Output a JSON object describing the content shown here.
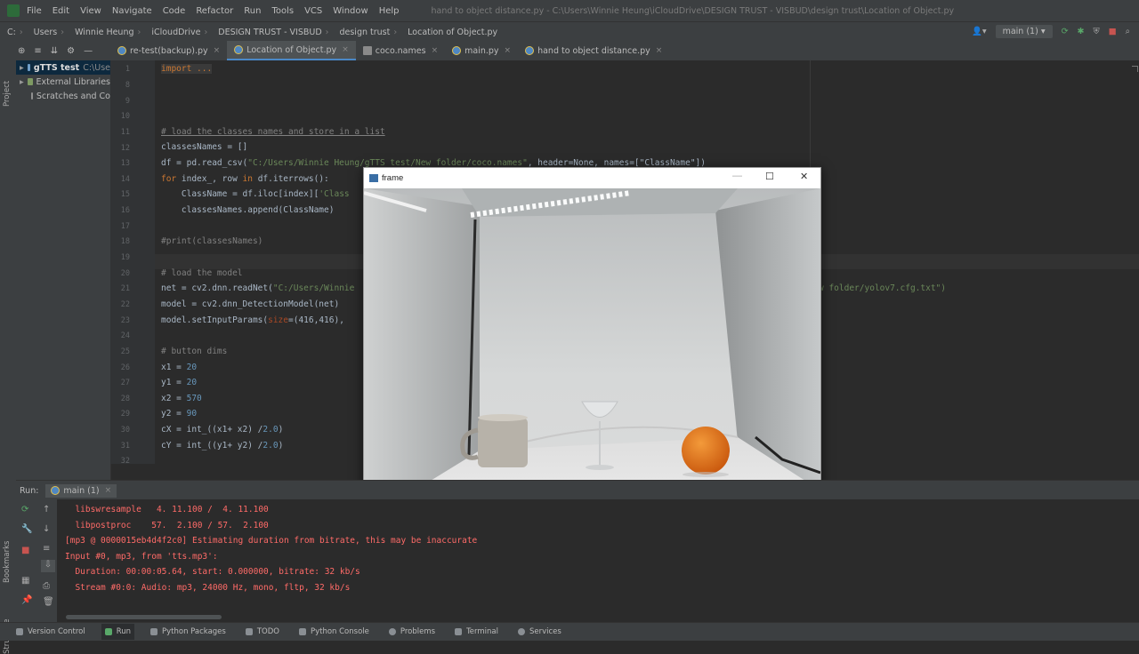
{
  "menu": {
    "items": [
      "File",
      "Edit",
      "View",
      "Navigate",
      "Code",
      "Refactor",
      "Run",
      "Tools",
      "VCS",
      "Window",
      "Help"
    ],
    "window_title": "hand to object distance.py - C:\\Users\\Winnie Heung\\iCloudDrive\\DESIGN TRUST - VISBUD\\design trust\\Location of Object.py"
  },
  "breadcrumb": [
    "C:",
    "Users",
    "Winnie Heung",
    "iCloudDrive",
    "DESIGN TRUST - VISBUD",
    "design trust",
    "Location of Object.py"
  ],
  "run_config": "main (1)",
  "project": {
    "side_label": "Project",
    "items": [
      {
        "label": "gTTS test",
        "path": "C:\\Use"
      },
      {
        "label": "External Libraries"
      },
      {
        "label": "Scratches and Co"
      }
    ]
  },
  "tabs": [
    {
      "label": "re-test(backup).py"
    },
    {
      "label": "Location of Object.py",
      "active": true
    },
    {
      "label": "coco.names"
    },
    {
      "label": "main.py"
    },
    {
      "label": "hand to object distance.py"
    }
  ],
  "line_numbers": [
    "1",
    "8",
    "9",
    "10",
    "11",
    "12",
    "13",
    "14",
    "15",
    "16",
    "17",
    "18",
    "19",
    "20",
    "21",
    "22",
    "23",
    "24",
    "25",
    "26",
    "27",
    "28",
    "29",
    "30",
    "31",
    "32"
  ],
  "code": {
    "l1": "import ...",
    "l11": "# load the classes names and store in a list",
    "l12": "classesNames = []",
    "l13a": "df = pd.read_csv(",
    "l13b": "\"C:/Users/Winnie Heung/gTTS test/New folder/coco.names\"",
    "l13c": ", header=None, names=[\"ClassName\"])",
    "l14a": "for",
    "l14b": " index_, row ",
    "l14c": "in",
    "l14d": " df.iterrows():",
    "l15a": "    ClassName = df.iloc[index][",
    "l15b": "'Class",
    "l16": "    classesNames.append(ClassName)",
    "l18": "#print(classesNames)",
    "l20": "# load the model",
    "l21a": "net = cv2.dnn.readNet(",
    "l21b": "\"C:/Users/Winnie",
    "l21c": "w folder/yolov7.cfg.txt\")",
    "l22": "model = cv2.dnn_DetectionModel(net)",
    "l23a": "model.setInputParams(",
    "l23b": "size",
    "l23c": "=(416,416),",
    "l25": "# button dims",
    "l26a": "x1 = ",
    "l26b": "20",
    "l27a": "y1 = ",
    "l27b": "20",
    "l28a": "x2 = ",
    "l28b": "570",
    "l29a": "y2 = ",
    "l29b": "90",
    "l30a": "cX = int_((x1+ x2) /",
    "l30b": "2.0",
    "l30c": ")",
    "l31a": "cY = int_((y1+ y2) /",
    "l31b": "2.0",
    "l31c": ")"
  },
  "frame_window": {
    "title": "frame",
    "minimize": "—",
    "maximize": "☐",
    "close": "✕"
  },
  "run_panel": {
    "label": "Run:",
    "tab": "main (1)",
    "lines": [
      "  libswresample   4. 11.100 /  4. 11.100",
      "  libpostproc    57.  2.100 / 57.  2.100",
      "[mp3 @ 0000015eb4d4f2c0] Estimating duration from bitrate, this may be inaccurate",
      "Input #0, mp3, from 'tts.mp3':",
      "  Duration: 00:00:05.64, start: 0.000000, bitrate: 32 kb/s",
      "  Stream #0:0: Audio: mp3, 24000 Hz, mono, fltp, 32 kb/s"
    ]
  },
  "left_strip_labels": [
    "Bookmarks",
    "Structure"
  ],
  "statusbar": [
    "Version Control",
    "Run",
    "Python Packages",
    "TODO",
    "Python Console",
    "Problems",
    "Terminal",
    "Services"
  ]
}
